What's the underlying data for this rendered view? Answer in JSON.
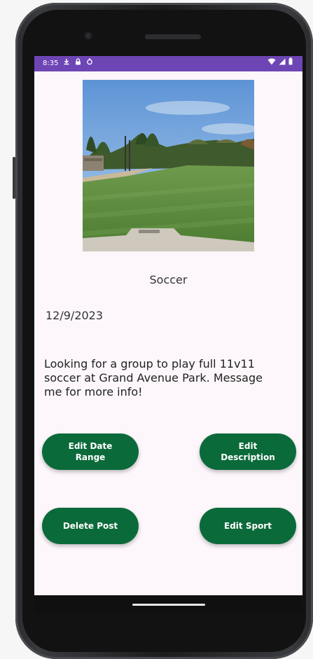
{
  "status_bar": {
    "time": "8:35",
    "icons_left": [
      "download-icon",
      "lock-icon",
      "sync-icon"
    ],
    "icons_right": [
      "wifi-icon",
      "signal-icon",
      "battery-icon"
    ],
    "color": "#6e45b5"
  },
  "post": {
    "sport": "Soccer",
    "date": "12/9/2023",
    "description": "Looking for a group to play full 11v11 soccer at Grand Avenue Park. Message me for more info!"
  },
  "buttons": {
    "edit_date_range": "Edit Date Range",
    "edit_description": "Edit Description",
    "delete_post": "Delete Post",
    "edit_sport": "Edit Sport",
    "color": "#0b6a3a"
  }
}
